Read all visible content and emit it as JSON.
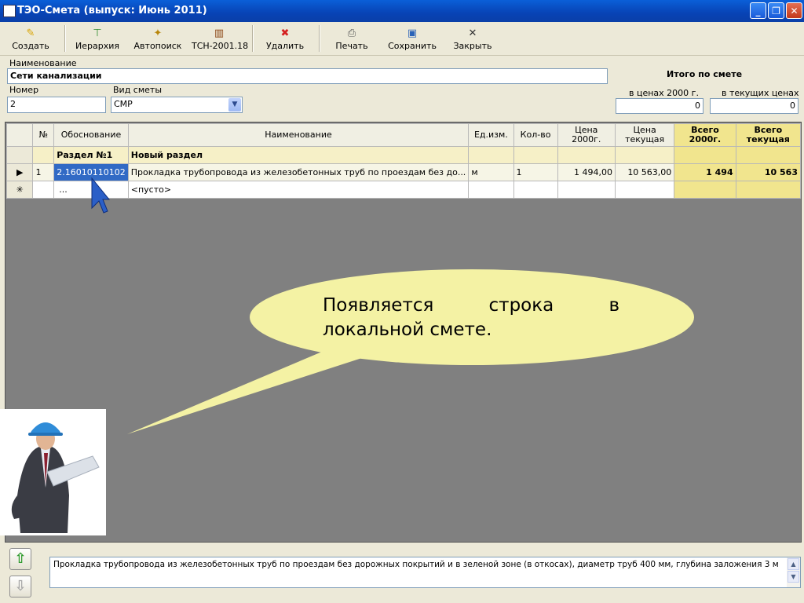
{
  "window": {
    "title": "ТЭО-Смета  (выпуск: Июнь 2011)",
    "min": "_",
    "max": "❐",
    "close": "✕"
  },
  "toolbar": {
    "create": "Создать",
    "hierarchy": "Иерархия",
    "autosearch": "Автопоиск",
    "tsn": "ТСН-2001.18",
    "delete": "Удалить",
    "print": "Печать",
    "save": "Сохранить",
    "close": "Закрыть"
  },
  "form": {
    "name_label": "Наименование",
    "name_value": "Сети канализации",
    "number_label": "Номер",
    "number_value": "2",
    "type_label": "Вид сметы",
    "type_value": "СМР",
    "totals_title": "Итого по смете",
    "price2000_label": "в ценах 2000 г.",
    "price2000_value": "0",
    "current_label": "в текущих ценах",
    "current_value": "0"
  },
  "grid": {
    "headers": {
      "num": "№",
      "basis": "Обоснование",
      "name": "Наименование",
      "unit": "Ед.изм.",
      "qty": "Кол-во",
      "price2000_l1": "Цена",
      "price2000_l2": "2000г.",
      "pricecur_l1": "Цена",
      "pricecur_l2": "текущая",
      "total2000_l1": "Всего",
      "total2000_l2": "2000г.",
      "totalcur_l1": "Всего",
      "totalcur_l2": "текущая"
    },
    "section": {
      "basis": "Раздел №1",
      "name": "Новый раздел"
    },
    "row": {
      "indicator": "▶",
      "num": "1",
      "basis": "2.16010110102",
      "name": "Прокладка трубопровода из железобетонных труб по проездам без до...",
      "unit": "м",
      "qty": "1",
      "price2000": "1 494,00",
      "pricecur": "10 563,00",
      "total2000": "1 494",
      "totalcur": "10 563"
    },
    "newrow": {
      "indicator": "✳",
      "basis": "...",
      "name": "<пусто>"
    }
  },
  "callout": {
    "line1": "Появляется строка в",
    "line2": "локальной смете."
  },
  "bottom": {
    "up": "⇧",
    "down": "⇩",
    "description": "Прокладка трубопровода из железобетонных труб по проездам без дорожных покрытий и в зеленой зоне (в откосах), диаметр труб 400 мм, глубина заложения 3 м"
  },
  "colors": {
    "titlebar": "#0A5FD8",
    "total_header": "#F1E58E",
    "selection": "#316AC5",
    "callout": "#F4F2A4"
  }
}
